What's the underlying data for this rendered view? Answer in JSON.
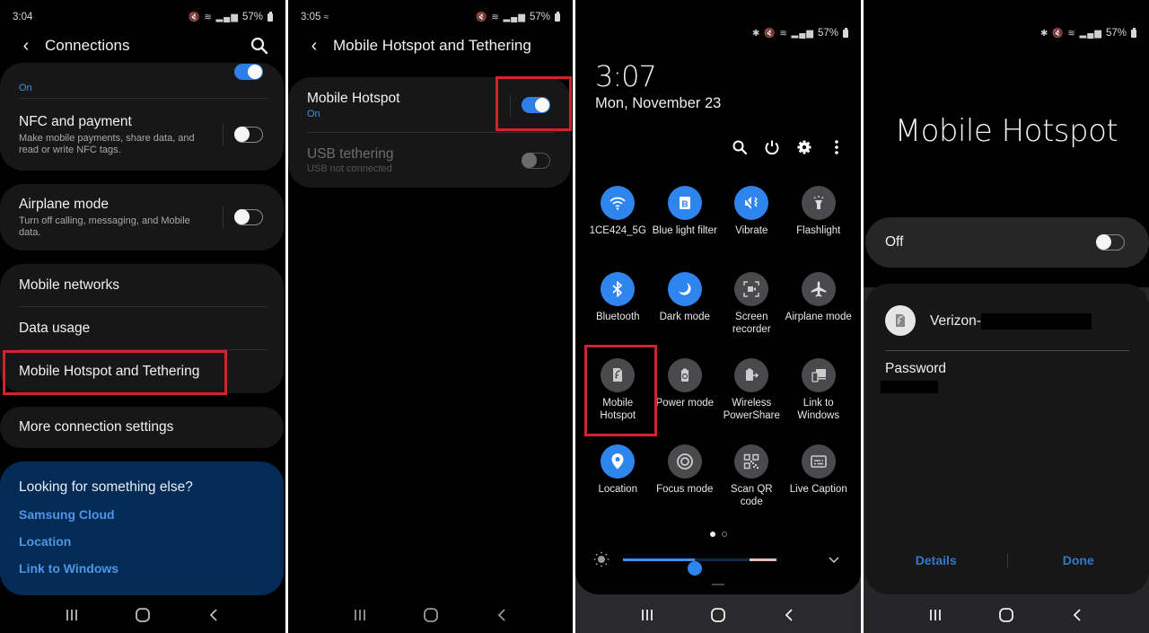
{
  "panel1": {
    "status": {
      "time": "3:04",
      "icons": "mute wifi signal",
      "battery": "57%"
    },
    "appbar": {
      "title": "Connections",
      "back_icon": "back-chevron-icon",
      "search_icon": "search-icon"
    },
    "partial_row": {
      "sub": "On",
      "toggle_on": true
    },
    "nfc": {
      "title": "NFC and payment",
      "sub": "Make mobile payments, share data, and read or write NFC tags.",
      "toggle_on": false
    },
    "airplane": {
      "title": "Airplane mode",
      "sub": "Turn off calling, messaging, and Mobile data.",
      "toggle_on": false
    },
    "group": [
      {
        "title": "Mobile networks"
      },
      {
        "title": "Data usage"
      },
      {
        "title": "Mobile Hotspot and Tethering",
        "highlighted": true
      }
    ],
    "more": {
      "title": "More connection settings"
    },
    "suggest": {
      "title": "Looking for something else?",
      "links": [
        "Samsung Cloud",
        "Location",
        "Link to Windows"
      ]
    }
  },
  "panel2": {
    "status": {
      "time": "3:05",
      "hotspot_indicator": "hotspot-icon",
      "icons": "mute wifi signal",
      "battery": "57%"
    },
    "appbar": {
      "title": "Mobile Hotspot and Tethering"
    },
    "hotspot": {
      "title": "Mobile Hotspot",
      "sub": "On",
      "toggle_on": true,
      "highlighted": true
    },
    "usb": {
      "title": "USB tethering",
      "sub": "USB not connected",
      "toggle_on": false,
      "disabled": true
    }
  },
  "panel3": {
    "status": {
      "icons": "bluetooth mute wifi signal",
      "battery": "57%"
    },
    "time": "3:07",
    "date": "Mon, November 23",
    "actions": [
      "search-icon",
      "power-icon",
      "settings-gear-icon",
      "more-vert-icon"
    ],
    "tiles": [
      {
        "label": "1CE424_5G",
        "icon": "wifi",
        "active": true
      },
      {
        "label": "Blue light filter",
        "icon": "blue-light",
        "active": true
      },
      {
        "label": "Vibrate",
        "icon": "vibrate",
        "active": true
      },
      {
        "label": "Flashlight",
        "icon": "flashlight",
        "active": false
      },
      {
        "label": "Bluetooth",
        "icon": "bluetooth",
        "active": true
      },
      {
        "label": "Dark mode",
        "icon": "moon",
        "active": true
      },
      {
        "label": "Screen recorder",
        "icon": "screen-recorder",
        "active": false
      },
      {
        "label": "Airplane mode",
        "icon": "airplane",
        "active": false
      },
      {
        "label": "Mobile Hotspot",
        "icon": "hotspot",
        "active": false,
        "highlighted": true
      },
      {
        "label": "Power mode",
        "icon": "power-mode",
        "active": false
      },
      {
        "label": "Wireless PowerShare",
        "icon": "powershare",
        "active": false
      },
      {
        "label": "Link to Windows",
        "icon": "link-windows",
        "active": false
      },
      {
        "label": "Location",
        "icon": "location",
        "active": true
      },
      {
        "label": "Focus mode",
        "icon": "focus",
        "active": false
      },
      {
        "label": "Scan QR code",
        "icon": "qr",
        "active": false
      },
      {
        "label": "Live Caption",
        "icon": "caption",
        "active": false
      }
    ],
    "page_indicator": {
      "current": 1,
      "total": 2
    },
    "brightness": {
      "level_percent": 47
    }
  },
  "panel4": {
    "status": {
      "icons": "bluetooth mute wifi signal",
      "battery": "57%"
    },
    "title": "Mobile Hotspot",
    "switch": {
      "label": "Off",
      "toggle_on": false
    },
    "network": {
      "ssid_prefix": "Verizon-",
      "password_label": "Password"
    },
    "buttons": {
      "details": "Details",
      "done": "Done"
    }
  },
  "colors": {
    "accent": "#2f85ee",
    "highlight": "#d0232b",
    "link": "#4f95e6",
    "suggest_bg": "#032b55"
  }
}
